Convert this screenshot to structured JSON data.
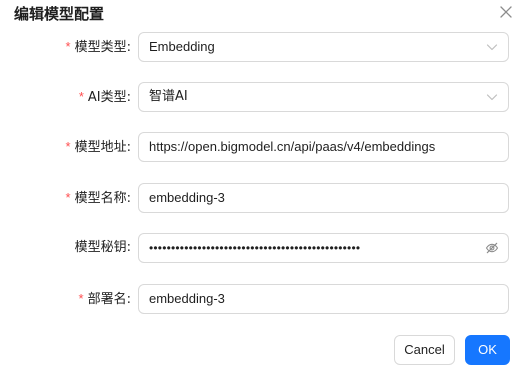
{
  "dialog": {
    "title": "编辑模型配置",
    "close_icon": "close-icon"
  },
  "form": {
    "model_type": {
      "label": "模型类型:",
      "required": true,
      "value": "Embedding",
      "control": "select"
    },
    "ai_type": {
      "label": "AI类型:",
      "required": true,
      "value": "智谱AI",
      "control": "select"
    },
    "model_url": {
      "label": "模型地址:",
      "required": true,
      "value": "https://open.bigmodel.cn/api/paas/v4/embeddings",
      "control": "input"
    },
    "model_name": {
      "label": "模型名称:",
      "required": true,
      "value": "embedding-3",
      "control": "input"
    },
    "model_secret": {
      "label": "模型秘钥:",
      "required": false,
      "value": "••••••••••••••••••••••••••••••••••••••••••••••••",
      "control": "password",
      "suffix_icon": "eye-invisible-icon"
    },
    "deployment_name": {
      "label": "部署名:",
      "required": true,
      "value": "embedding-3",
      "control": "input"
    }
  },
  "footer": {
    "cancel_label": "Cancel",
    "ok_label": "OK"
  },
  "colors": {
    "primary": "#1677ff",
    "required_mark": "#ff4d4f",
    "border": "#d9d9d9"
  }
}
